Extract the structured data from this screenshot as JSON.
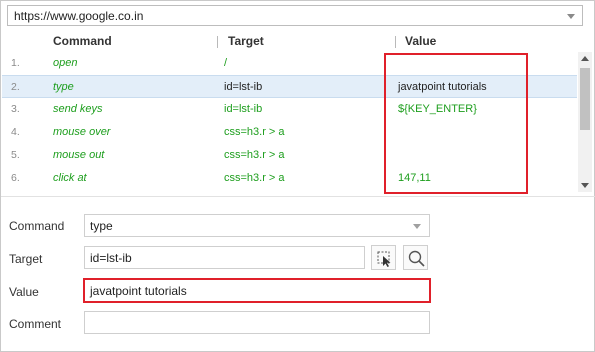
{
  "url_bar": {
    "value": "https://www.google.co.in"
  },
  "table": {
    "columns": [
      "Command",
      "Target",
      "Value"
    ],
    "rows": [
      {
        "num": "1.",
        "command": "open",
        "target": "/",
        "value": ""
      },
      {
        "num": "2.",
        "command": "type",
        "target": "id=lst-ib",
        "value": "javatpoint tutorials"
      },
      {
        "num": "3.",
        "command": "send keys",
        "target": "id=lst-ib",
        "value": "${KEY_ENTER}"
      },
      {
        "num": "4.",
        "command": "mouse over",
        "target": "css=h3.r > a",
        "value": ""
      },
      {
        "num": "5.",
        "command": "mouse out",
        "target": "css=h3.r > a",
        "value": ""
      },
      {
        "num": "6.",
        "command": "click at",
        "target": "css=h3.r > a",
        "value": "147,11"
      }
    ],
    "selected_row": 2
  },
  "form": {
    "command_label": "Command",
    "command_value": "type",
    "target_label": "Target",
    "target_value": "id=lst-ib",
    "value_label": "Value",
    "value_value": "javatpoint tutorials",
    "comment_label": "Comment",
    "comment_value": ""
  },
  "colors": {
    "command_text": "#1d9e1d",
    "selected_row": "#e3eef9",
    "highlight": "#e0202a"
  },
  "icons": [
    "chevron-down-icon",
    "scroll-up-icon",
    "scroll-down-icon",
    "select-target-icon",
    "search-icon"
  ]
}
